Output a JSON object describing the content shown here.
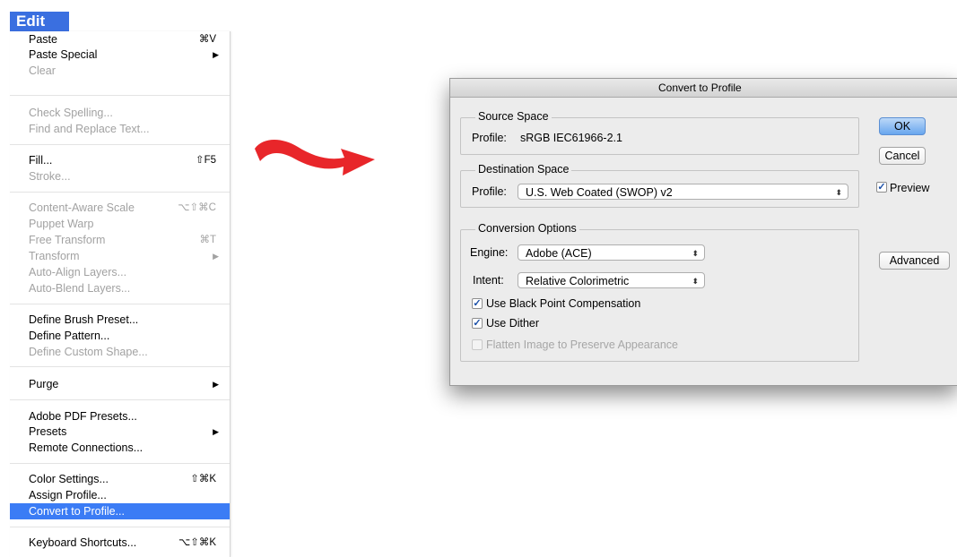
{
  "menu": {
    "title": "Edit",
    "items": [
      {
        "label": "Paste",
        "shortcut": "⌘V"
      },
      {
        "label": "Paste Special",
        "submenu": "▶"
      },
      {
        "label": "Clear"
      },
      {
        "label": "Check Spelling..."
      },
      {
        "label": "Find and Replace Text..."
      },
      {
        "label": "Fill...",
        "shortcut": "⇧F5"
      },
      {
        "label": "Stroke..."
      },
      {
        "label": "Content-Aware Scale",
        "shortcut": "⌥⇧⌘C"
      },
      {
        "label": "Puppet Warp"
      },
      {
        "label": "Free Transform",
        "shortcut": "⌘T"
      },
      {
        "label": "Transform",
        "submenu": "▶"
      },
      {
        "label": "Auto-Align Layers..."
      },
      {
        "label": "Auto-Blend Layers..."
      },
      {
        "label": "Define Brush Preset..."
      },
      {
        "label": "Define Pattern..."
      },
      {
        "label": "Define Custom Shape..."
      },
      {
        "label": "Purge",
        "submenu": "▶"
      },
      {
        "label": "Adobe PDF Presets..."
      },
      {
        "label": "Presets",
        "submenu": "▶"
      },
      {
        "label": "Remote Connections..."
      },
      {
        "label": "Color Settings...",
        "shortcut": "⇧⌘K"
      },
      {
        "label": "Assign Profile..."
      },
      {
        "label": "Convert to Profile..."
      },
      {
        "label": "Keyboard Shortcuts...",
        "shortcut": "⌥⇧⌘K"
      }
    ]
  },
  "dialog": {
    "title": "Convert to Profile",
    "source": {
      "group": "Source Space",
      "profile_label": "Profile:",
      "profile_value": "sRGB IEC61966-2.1"
    },
    "destination": {
      "group": "Destination Space",
      "profile_label": "Profile:",
      "profile_value": "U.S. Web Coated (SWOP) v2",
      "popup_arrow": "⬍"
    },
    "conversion": {
      "group": "Conversion Options",
      "engine_label": "Engine:",
      "engine_value": "Adobe (ACE)",
      "intent_label": "Intent:",
      "intent_value": "Relative Colorimetric",
      "popup_arrow": "⬍",
      "black_point": {
        "label": "Use Black Point Compensation",
        "checked": true
      },
      "dither": {
        "label": "Use Dither",
        "checked": true
      },
      "flatten": {
        "label": "Flatten Image to Preserve Appearance",
        "checked": false,
        "disabled": true
      }
    },
    "buttons": {
      "ok": "OK",
      "cancel": "Cancel",
      "advanced": "Advanced"
    },
    "preview": {
      "label": "Preview",
      "checked": true
    },
    "check_mark": "✓"
  },
  "colors": {
    "menu_highlight": "#3b7cf5",
    "edit_title_bg": "#3a6fe0",
    "arrow": "#e8262a",
    "ok_button": "#68a6ee"
  },
  "icons": {
    "arrow": "red-curved-arrow-icon",
    "submenu": "triangle-right-icon",
    "popup": "updown-chevron-icon",
    "check": "checkmark-icon"
  }
}
